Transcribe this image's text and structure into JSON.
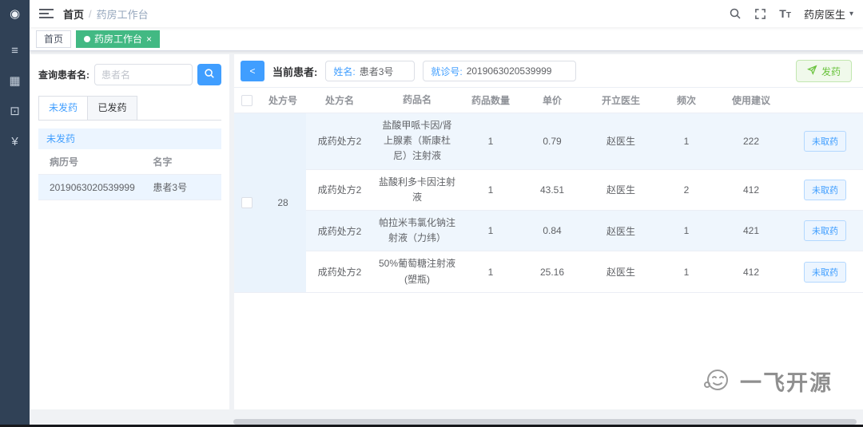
{
  "colors": {
    "accent": "#409eff",
    "success": "#42b983",
    "sidebar_bg": "#304156",
    "row_highlight": "#ecf5ff"
  },
  "sidebar": {
    "items": [
      {
        "name": "dashboard",
        "glyph": "◉"
      },
      {
        "name": "form",
        "glyph": "≡"
      },
      {
        "name": "table",
        "glyph": "▦"
      },
      {
        "name": "edit",
        "glyph": "⊡"
      },
      {
        "name": "money",
        "glyph": "¥"
      }
    ]
  },
  "header": {
    "breadcrumb": {
      "home": "首页",
      "separator": "/",
      "current": "药房工作台"
    },
    "size_icon_big": "T",
    "size_icon_small": "T",
    "user_name": "药房医生",
    "caret": "▾"
  },
  "tags": {
    "items": [
      {
        "label": "首页"
      },
      {
        "label": "药房工作台",
        "close": "×"
      }
    ]
  },
  "left_panel": {
    "query_label": "查询患者名:",
    "query_placeholder": "患者名",
    "tab_pending": "未发药",
    "tab_done": "已发药",
    "list_title": "未发药",
    "col_record": "病历号",
    "col_name": "名字",
    "patient": {
      "record_no": "2019063020539999",
      "name": "患者3号"
    }
  },
  "patient_bar": {
    "back": "<",
    "label": "当前患者:",
    "name_label": "姓名:",
    "name_value": "患者3号",
    "visit_label": "就诊号:",
    "visit_value": "2019063020539999",
    "dispense": "发药"
  },
  "rx_table": {
    "columns": {
      "no": "处方号",
      "name": "处方名",
      "drug": "药品名",
      "qty": "药品数量",
      "price": "单价",
      "doctor": "开立医生",
      "freq": "频次",
      "advice": "使用建议"
    },
    "prescription_no": "28",
    "rows": [
      {
        "name": "成药处方2",
        "drug": "盐酸甲哌卡因/肾上腺素（斯康杜尼）注射液",
        "qty": "1",
        "price": "0.79",
        "doctor": "赵医生",
        "freq": "1",
        "advice": "222",
        "action": "未取药"
      },
      {
        "name": "成药处方2",
        "drug": "盐酸利多卡因注射液",
        "qty": "1",
        "price": "43.51",
        "doctor": "赵医生",
        "freq": "2",
        "advice": "412",
        "action": "未取药"
      },
      {
        "name": "成药处方2",
        "drug": "帕拉米韦氯化钠注射液（力纬）",
        "qty": "1",
        "price": "0.84",
        "doctor": "赵医生",
        "freq": "1",
        "advice": "421",
        "action": "未取药"
      },
      {
        "name": "成药处方2",
        "drug": "50%葡萄糖注射液(塑瓶)",
        "qty": "1",
        "price": "25.16",
        "doctor": "赵医生",
        "freq": "1",
        "advice": "412",
        "action": "未取药"
      }
    ]
  },
  "watermark": {
    "text": "一飞开源"
  }
}
